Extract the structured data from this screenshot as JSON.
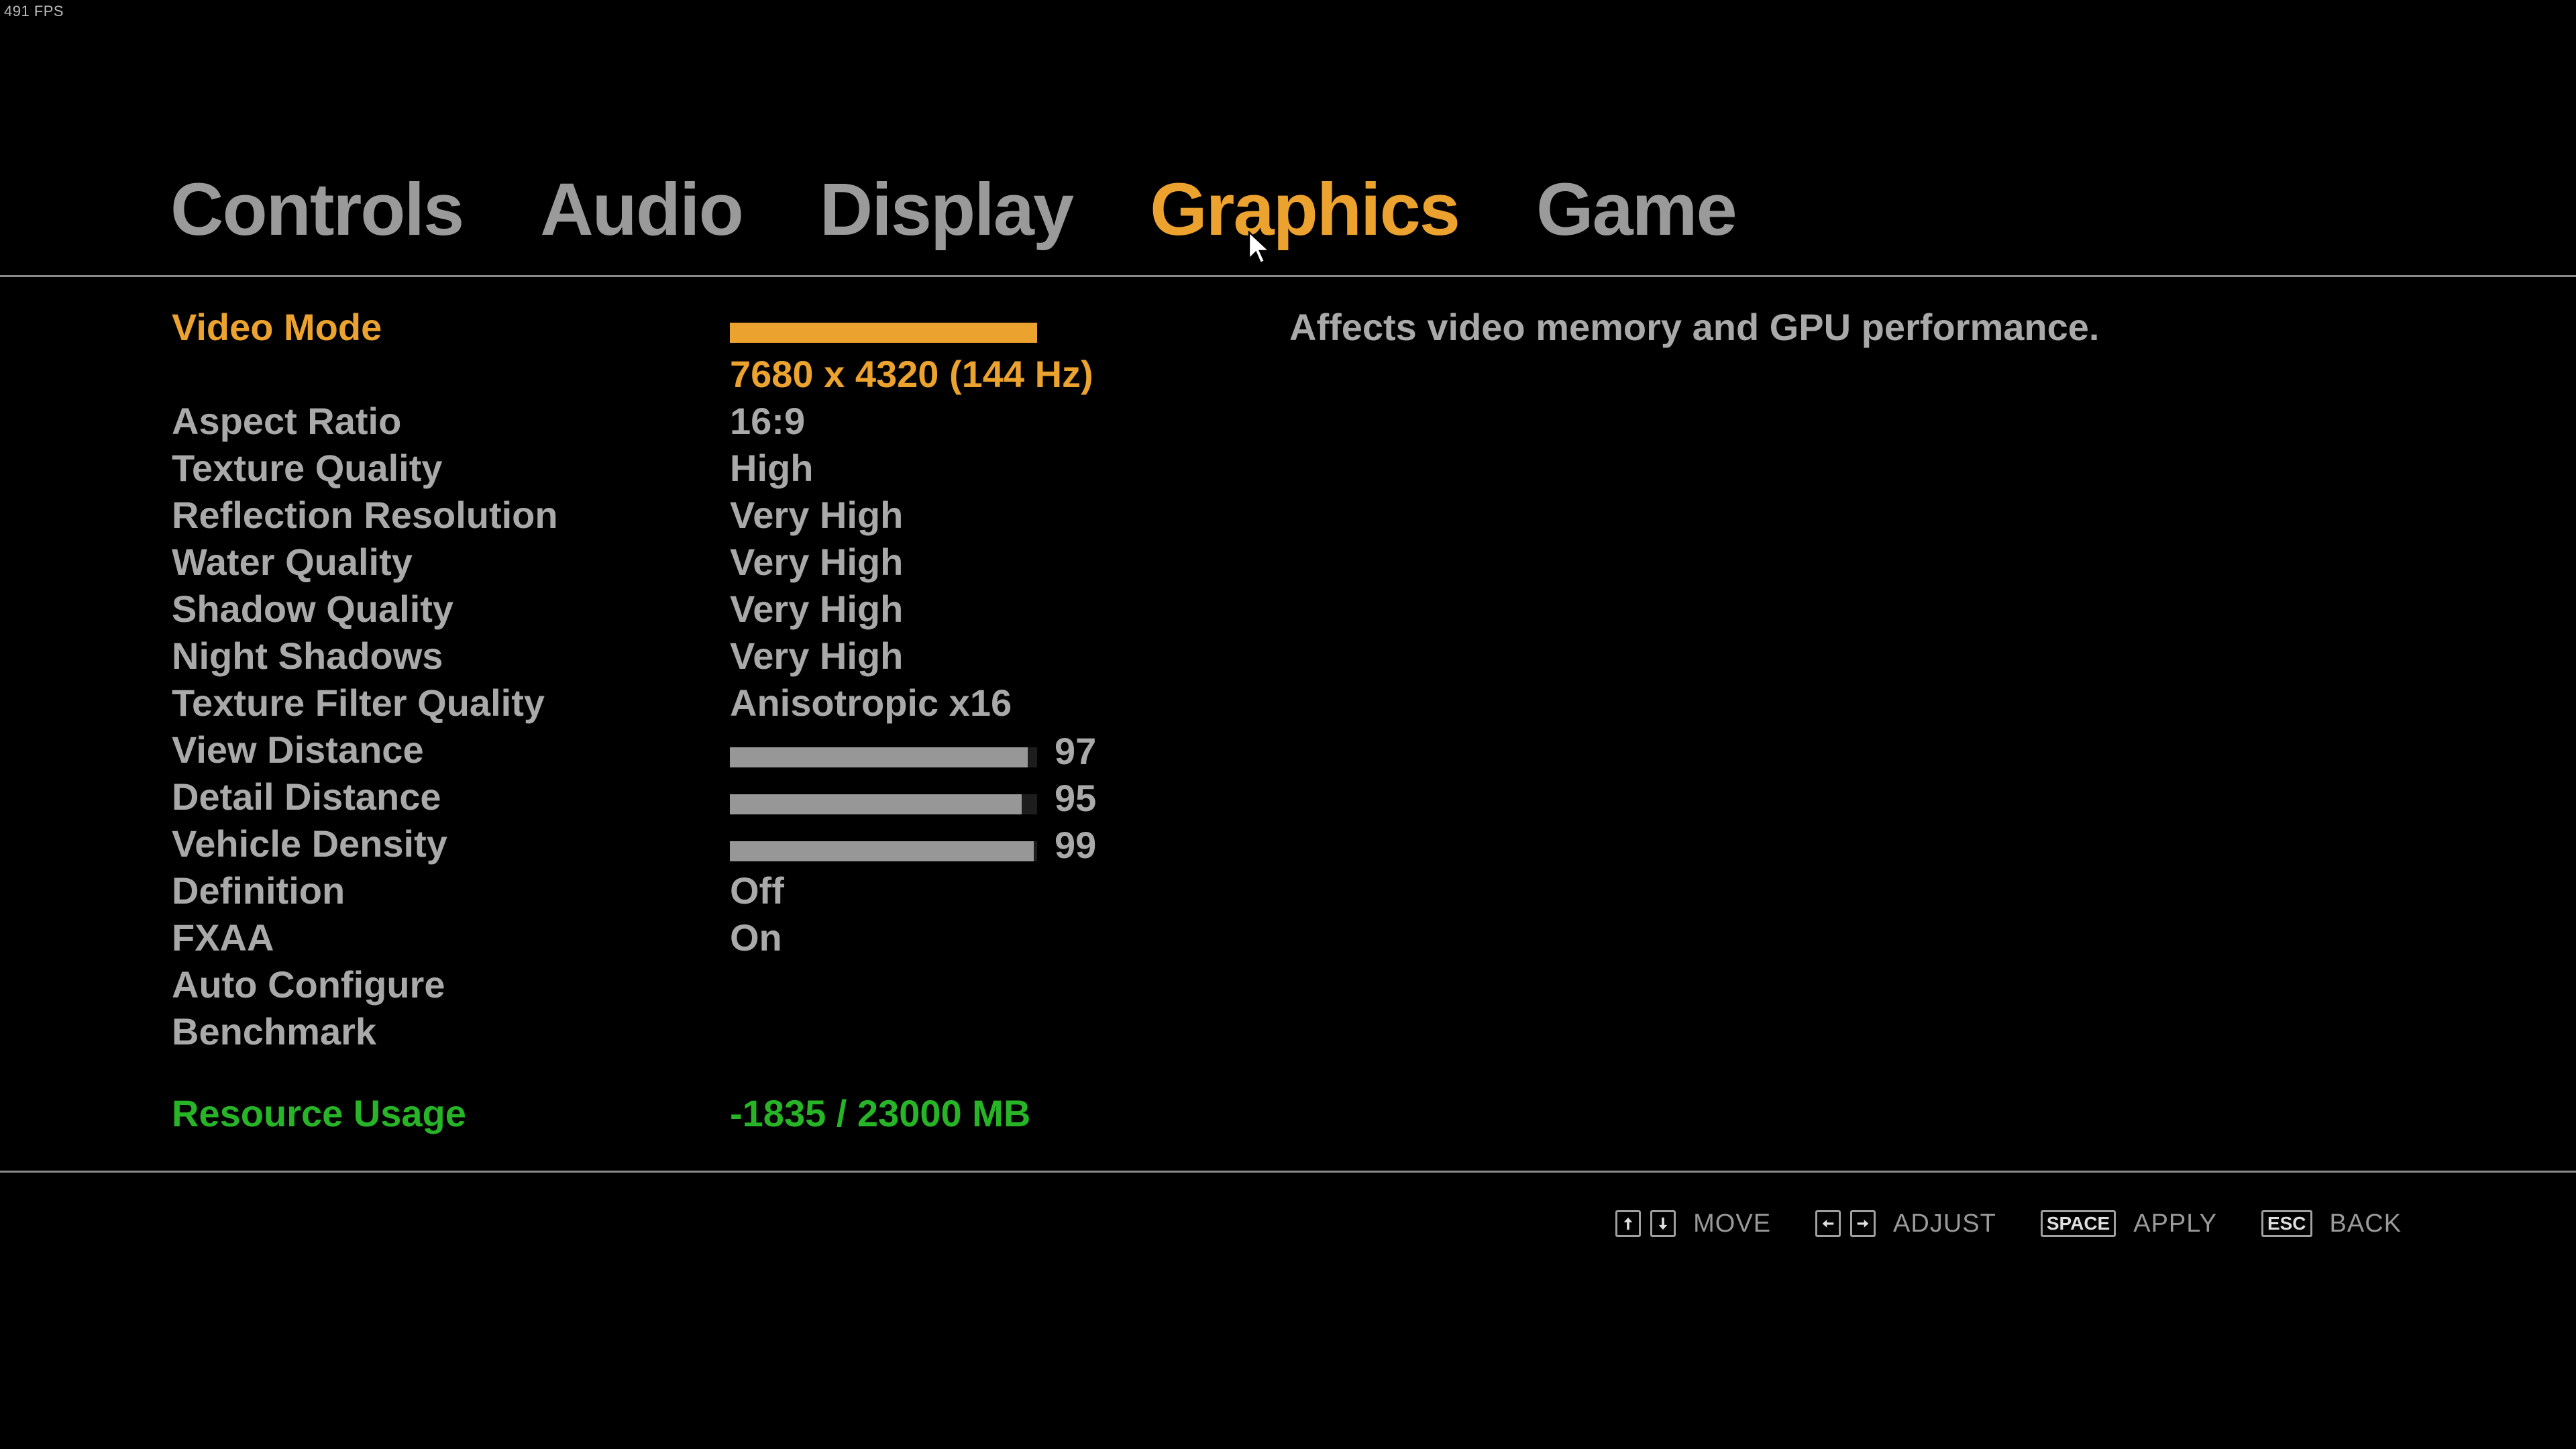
{
  "fps": "491 FPS",
  "tabs": [
    {
      "label": "Controls",
      "active": false
    },
    {
      "label": "Audio",
      "active": false
    },
    {
      "label": "Display",
      "active": false
    },
    {
      "label": "Graphics",
      "active": true
    },
    {
      "label": "Game",
      "active": false
    }
  ],
  "settings": {
    "video_mode": {
      "label": "Video Mode",
      "value": "7680 x 4320 (144 Hz)"
    },
    "aspect_ratio": {
      "label": "Aspect Ratio",
      "value": "16:9"
    },
    "texture_quality": {
      "label": "Texture Quality",
      "value": "High"
    },
    "reflection_resolution": {
      "label": "Reflection Resolution",
      "value": "Very High"
    },
    "water_quality": {
      "label": "Water Quality",
      "value": "Very High"
    },
    "shadow_quality": {
      "label": "Shadow Quality",
      "value": "Very High"
    },
    "night_shadows": {
      "label": "Night Shadows",
      "value": "Very High"
    },
    "texture_filter_quality": {
      "label": "Texture Filter Quality",
      "value": "Anisotropic x16"
    },
    "view_distance": {
      "label": "View Distance",
      "value": 97,
      "max": 100
    },
    "detail_distance": {
      "label": "Detail Distance",
      "value": 95,
      "max": 100
    },
    "vehicle_density": {
      "label": "Vehicle Density",
      "value": 99,
      "max": 100
    },
    "definition": {
      "label": "Definition",
      "value": "Off"
    },
    "fxaa": {
      "label": "FXAA",
      "value": "On"
    },
    "auto_configure": {
      "label": "Auto Configure"
    },
    "benchmark": {
      "label": "Benchmark"
    },
    "resource_usage": {
      "label": "Resource Usage",
      "value": "-1835 / 23000 MB"
    }
  },
  "description": "Affects video memory and GPU performance.",
  "hints": {
    "move": {
      "label": "MOVE"
    },
    "adjust": {
      "label": "ADJUST"
    },
    "apply": {
      "key": "SPACE",
      "label": "APPLY"
    },
    "back": {
      "key": "ESC",
      "label": "BACK"
    }
  },
  "colors": {
    "accent": "#eca22e",
    "resource": "#27b427",
    "text": "#a9a9a9",
    "slider_fill": "#979797"
  },
  "icons": [
    "arrow-up-icon",
    "arrow-down-icon",
    "arrow-left-icon",
    "arrow-right-icon",
    "mouse-cursor-icon"
  ]
}
